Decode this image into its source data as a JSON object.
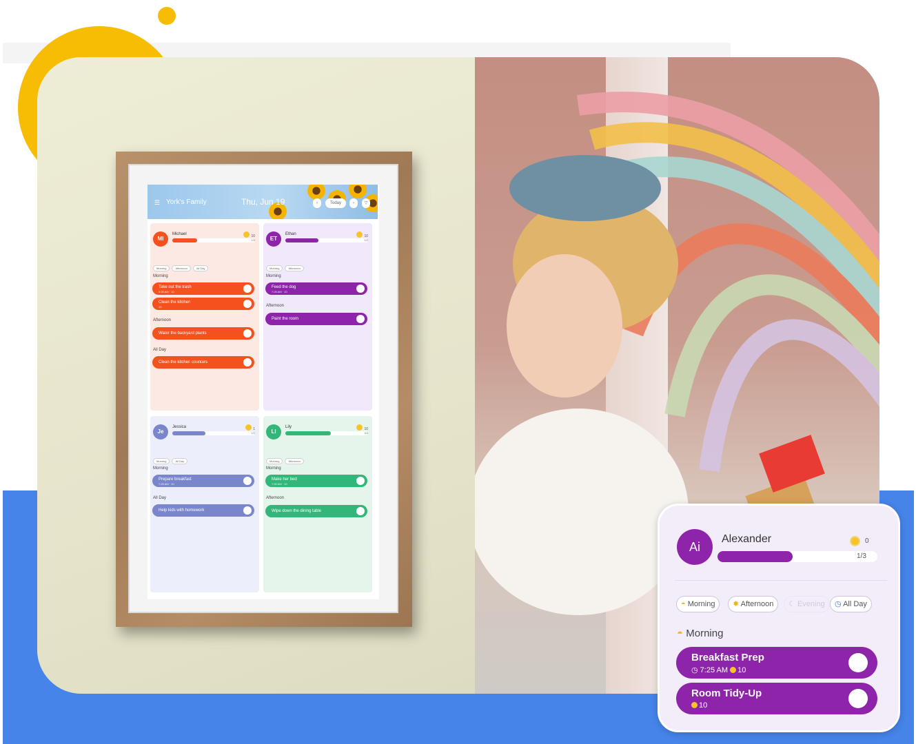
{
  "colors": {
    "blue_band": "#4684ea",
    "sun": "#f7bd05",
    "purple": "#8e24aa",
    "orange": "#f4511e",
    "indigo": "#7986cb",
    "green": "#33b679"
  },
  "tablet": {
    "header": {
      "menu_icon": "menu-icon",
      "family_name": "York's Family",
      "date": "Thu, Jun 19",
      "prev_icon": "chevron-left-icon",
      "today_label": "Today",
      "next_icon": "chevron-right-icon",
      "filter_icon": "filter-icon"
    },
    "members": [
      {
        "initials": "MI",
        "name": "Michael",
        "coins": "10",
        "count": "1/5",
        "progress": 0.3,
        "chips": [
          "Morning",
          "Afternoon",
          "All Day"
        ],
        "sections": [
          {
            "label": "Morning",
            "tasks": [
              {
                "title": "Take out the trash",
                "sub": "6:26 AM · 10"
              },
              {
                "title": "Clean the kitchen",
                "sub": "10"
              }
            ]
          },
          {
            "label": "Afternoon",
            "tasks": [
              {
                "title": "Water the backyard plants",
                "sub": ""
              }
            ]
          },
          {
            "label": "All Day",
            "tasks": [
              {
                "title": "Clean the kitchen counters",
                "sub": ""
              }
            ]
          }
        ]
      },
      {
        "initials": "ET",
        "name": "Ethan",
        "coins": "10",
        "count": "1/2",
        "progress": 0.4,
        "chips": [
          "Morning",
          "Afternoon"
        ],
        "sections": [
          {
            "label": "Morning",
            "tasks": [
              {
                "title": "Feed the dog",
                "sub": "7:25 AM · 10"
              }
            ]
          },
          {
            "label": "Afternoon",
            "tasks": [
              {
                "title": "Paint the room",
                "sub": ""
              }
            ]
          }
        ]
      },
      {
        "initials": "Je",
        "name": "Jessica",
        "coins": "1",
        "count": "1/2",
        "progress": 0.4,
        "chips": [
          "Morning",
          "All Day"
        ],
        "sections": [
          {
            "label": "Morning",
            "tasks": [
              {
                "title": "Prepare breakfast",
                "sub": "7:25 AM · 10"
              }
            ]
          },
          {
            "label": "All Day",
            "tasks": [
              {
                "title": "Help kids with homework",
                "sub": ""
              }
            ]
          }
        ]
      },
      {
        "initials": "LI",
        "name": "Lily",
        "coins": "10",
        "count": "3/4",
        "progress": 0.55,
        "chips": [
          "Morning",
          "Afternoon"
        ],
        "sections": [
          {
            "label": "Morning",
            "tasks": [
              {
                "title": "Make her bed",
                "sub": "7:30 AM · 10"
              }
            ]
          },
          {
            "label": "Afternoon",
            "tasks": [
              {
                "title": "Wipe down the dining table",
                "sub": ""
              }
            ]
          }
        ]
      }
    ]
  },
  "popup": {
    "initials": "Ai",
    "name": "Alexander",
    "coins": "0",
    "count": "1/3",
    "progress": 0.47,
    "chips": [
      {
        "label": "Morning",
        "icon": "sunrise-icon",
        "faded": false
      },
      {
        "label": "Afternoon",
        "icon": "sun-icon",
        "faded": false
      },
      {
        "label": "Evening",
        "icon": "moon-icon",
        "faded": true
      },
      {
        "label": "All Day",
        "icon": "clock-icon",
        "faded": false
      }
    ],
    "section_label": "Morning",
    "section_icon": "sunrise-icon",
    "tasks": [
      {
        "title": "Breakfast Prep",
        "time": "7:25 AM",
        "coins": "10"
      },
      {
        "title": "Room Tidy-Up",
        "time": "",
        "coins": "10"
      }
    ]
  }
}
